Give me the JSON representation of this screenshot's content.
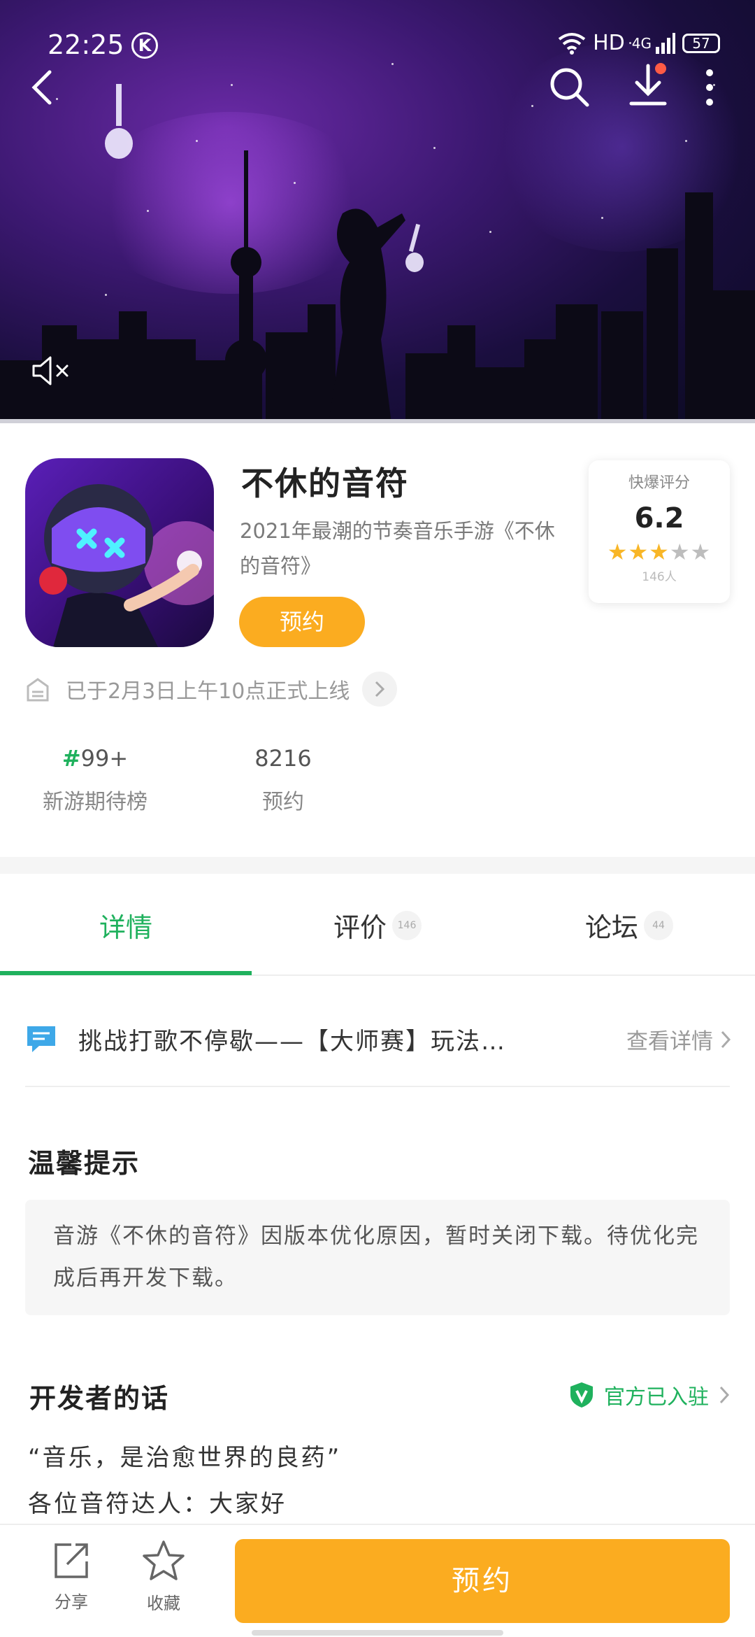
{
  "status_bar": {
    "time": "22:25",
    "k_badge": "K",
    "network": "HD",
    "signal_type": "4G",
    "battery": "57"
  },
  "hero": {
    "icons": [
      "back-arrow-icon",
      "search-icon",
      "download-icon",
      "more-icon",
      "mute-icon"
    ]
  },
  "app": {
    "title": "不休的音符",
    "description": "2021年最潮的节奏音乐手游《不休的音符》",
    "reserve_button": "预约",
    "rating": {
      "label": "快爆评分",
      "score": "6.2",
      "stars_filled": 3,
      "stars_total": 5,
      "count": "146人"
    },
    "launch_notice": "已于2月3日上午10点正式上线",
    "stats": [
      {
        "value_hash": "#",
        "value": "99+",
        "label": "新游期待榜"
      },
      {
        "value_hash": "",
        "value": "8216",
        "label": "预约"
      }
    ]
  },
  "tabs": [
    {
      "label": "详情",
      "count": ""
    },
    {
      "label": "评价",
      "count": "146"
    },
    {
      "label": "论坛",
      "count": "44"
    }
  ],
  "notice": {
    "text": "挑战打歌不停歇——【大师赛】玩法…",
    "link": "查看详情"
  },
  "tips": {
    "title": "温馨提示",
    "body": "音游《不休的音符》因版本优化原因，暂时关闭下载。待优化完成后再开发下载。"
  },
  "developer": {
    "title": "开发者的话",
    "official": "官方已入驻",
    "line1": "“音乐，是治愈世界的良药”",
    "line2": "各位音符达人：大家好"
  },
  "bottom_bar": {
    "share": "分享",
    "favorite": "收藏",
    "reserve": "预约"
  },
  "colors": {
    "accent_green": "#1fb15d",
    "accent_orange": "#fbac20",
    "star_yellow": "#f8b627"
  }
}
